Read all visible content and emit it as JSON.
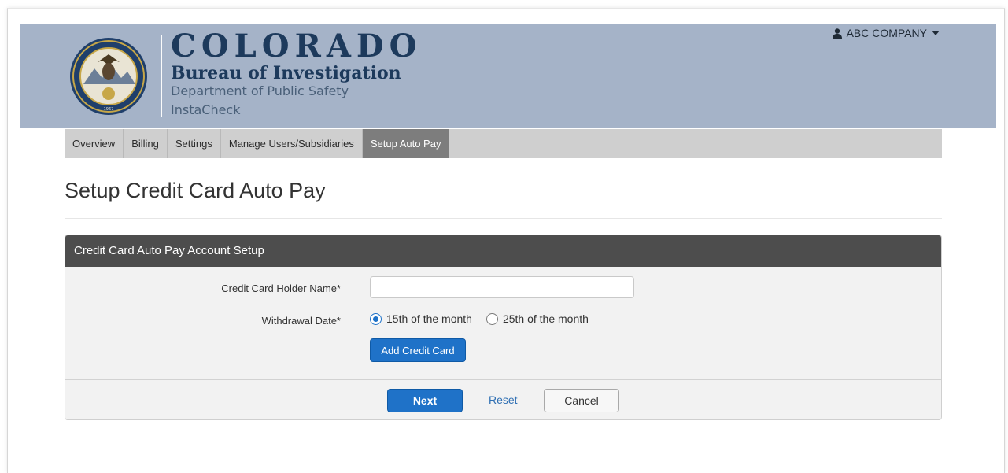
{
  "header": {
    "title": "COLORADO",
    "subtitle": "Bureau of Investigation",
    "department": "Department of Public Safety",
    "app_name": "InstaCheck",
    "seal_text_top": "COLORADO BUREAU OF INVESTIGATION",
    "seal_year": "1967",
    "background_color": "#a5b3c8"
  },
  "user_menu": {
    "label": "ABC COMPANY",
    "icon": "user-icon",
    "caret": "caret-down-icon"
  },
  "nav": {
    "tabs": [
      {
        "label": "Overview",
        "active": false
      },
      {
        "label": "Billing",
        "active": false
      },
      {
        "label": "Settings",
        "active": false
      },
      {
        "label": "Manage Users/Subsidiaries",
        "active": false
      },
      {
        "label": "Setup Auto Pay",
        "active": true
      }
    ]
  },
  "page": {
    "title": "Setup Credit Card Auto Pay"
  },
  "form": {
    "panel_title": "Credit Card Auto Pay Account Setup",
    "holder_name_label": "Credit Card Holder Name*",
    "holder_name_value": "",
    "withdrawal_label": "Withdrawal Date*",
    "withdrawal_options": [
      {
        "label": "15th of the month",
        "checked": true
      },
      {
        "label": "25th of the month",
        "checked": false
      }
    ],
    "add_card_label": "Add Credit Card"
  },
  "footer": {
    "next_label": "Next",
    "reset_label": "Reset",
    "cancel_label": "Cancel"
  },
  "colors": {
    "accent": "#1f72c8",
    "panel_header": "#4d4d4d",
    "active_tab": "#7d7d7d"
  }
}
